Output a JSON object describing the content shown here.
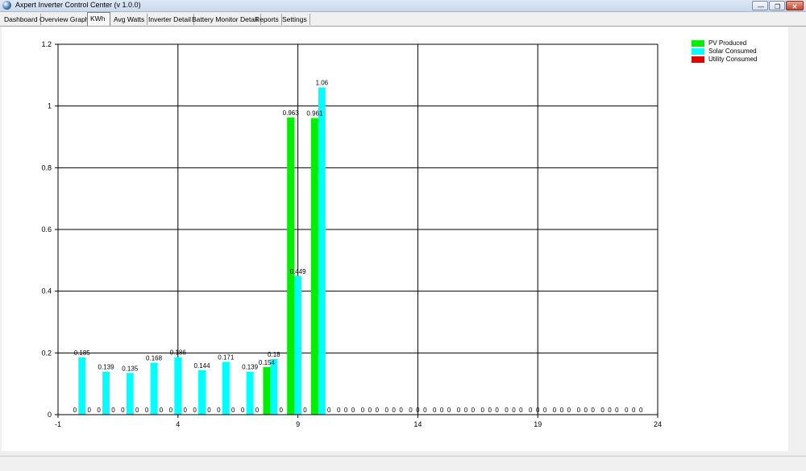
{
  "window": {
    "title": "Axpert Inverter Control Center  (v 1.0.0)",
    "minimize_glyph": "—",
    "maximize_glyph": "❐",
    "close_glyph": "✕"
  },
  "tabs": [
    {
      "label": "Dashboard",
      "active": false
    },
    {
      "label": "Overview Graph",
      "active": false
    },
    {
      "label": "KWh",
      "active": true
    },
    {
      "label": "Avg Watts",
      "active": false
    },
    {
      "label": "Inverter Detail",
      "active": false
    },
    {
      "label": "Battery Monitor Detail",
      "active": false
    },
    {
      "label": "Reports",
      "active": false
    },
    {
      "label": "Settings",
      "active": false
    }
  ],
  "colors": {
    "pv_produced": "#00ee00",
    "solar_consumed": "#00ffff",
    "utility_consumed": "#e00000"
  },
  "chart_data": {
    "type": "bar",
    "xlim": [
      -1,
      24
    ],
    "ylim": [
      0,
      1.2
    ],
    "x_ticks": [
      -1,
      4,
      9,
      14,
      19,
      24
    ],
    "y_ticks": [
      0,
      0.2,
      0.4,
      0.6,
      0.8,
      1,
      1.2
    ],
    "x_tick_labels": [
      "-1",
      "4",
      "9",
      "14",
      "19",
      "24"
    ],
    "y_tick_labels": [
      "0",
      "0.2",
      "0.4",
      "0.6",
      "0.8",
      "1",
      "1.2"
    ],
    "grid": true,
    "legend_position": "top-right",
    "x": [
      0,
      1,
      2,
      3,
      4,
      5,
      6,
      7,
      8,
      9,
      10,
      11,
      12,
      13,
      14,
      15,
      16,
      17,
      18,
      19,
      20,
      21,
      22,
      23
    ],
    "series": [
      {
        "name": "PV Produced",
        "values": [
          0,
          0,
          0,
          0,
          0,
          0,
          0,
          0,
          0.154,
          0.963,
          0.961,
          0,
          0,
          0,
          0,
          0,
          0,
          0,
          0,
          0,
          0,
          0,
          0,
          0
        ],
        "labels": [
          "0",
          "0",
          "0",
          "0",
          "0",
          "0",
          "0",
          "0",
          "0.154",
          "0.963",
          "0.961",
          "0",
          "0",
          "0",
          "0",
          "0",
          "0",
          "0",
          "0",
          "0",
          "0",
          "0",
          "0",
          "0"
        ]
      },
      {
        "name": "Solar Consumed",
        "values": [
          0.185,
          0.139,
          0.135,
          0.168,
          0.186,
          0.144,
          0.171,
          0.139,
          0.18,
          0.449,
          1.06,
          0,
          0,
          0,
          0,
          0,
          0,
          0,
          0,
          0,
          0,
          0,
          0,
          0
        ],
        "labels": [
          "0.185",
          "0.139",
          "0.135",
          "0.168",
          "0.186",
          "0.144",
          "0.171",
          "0.139",
          "0.18",
          "0.449",
          "1.06",
          "0",
          "0",
          "0",
          "0",
          "0",
          "0",
          "0",
          "0",
          "0",
          "0",
          "0",
          "0",
          "0"
        ]
      },
      {
        "name": "Utility Consumed",
        "values": [
          0,
          0,
          0,
          0,
          0,
          0,
          0,
          0,
          0,
          0,
          0,
          0,
          0,
          0,
          0,
          0,
          0,
          0,
          0,
          0,
          0,
          0,
          0,
          0
        ],
        "labels": [
          "0",
          "0",
          "0",
          "0",
          "0",
          "0",
          "0",
          "0",
          "0",
          "0",
          "0",
          "0",
          "0",
          "0",
          "0",
          "0",
          "0",
          "0",
          "0",
          "0",
          "0",
          "0",
          "0",
          "0"
        ]
      }
    ]
  }
}
